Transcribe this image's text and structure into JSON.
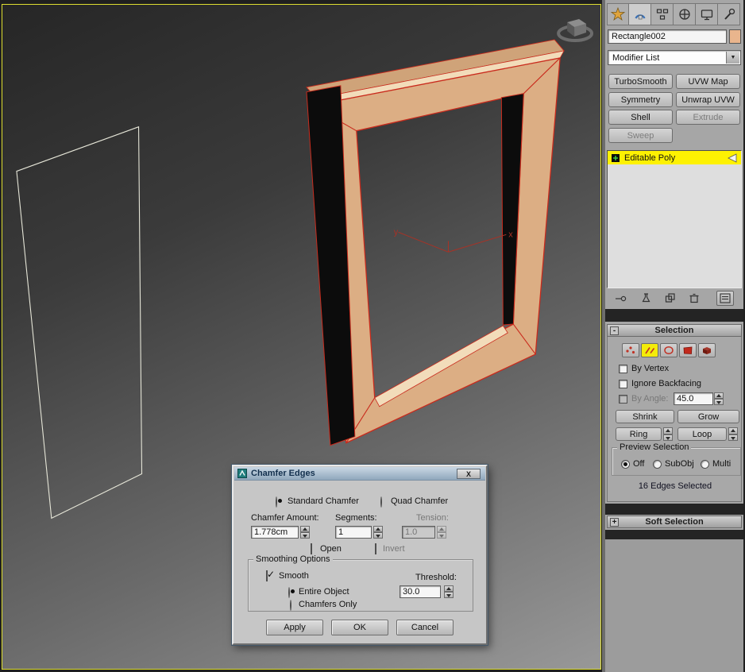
{
  "glyphs": {
    "dropdown_arrow": "▼",
    "collapse_minus": "-",
    "expand_plus": "+"
  },
  "colors": {
    "active_border_yellow": "#dede30",
    "selection_red": "#c92b1d",
    "frame_tan": "#dcae84",
    "frame_chamfer_light": "#f2dcba",
    "stack_highlight_yellow": "#fdf102",
    "object_color_swatch": "#e9b58d"
  },
  "viewport": {
    "axis_x_label": "x",
    "axis_y_label": "y"
  },
  "command_panel": {
    "tabs": [
      "create",
      "modify",
      "hierarchy",
      "motion",
      "display",
      "utilities"
    ],
    "active_tab": "modify",
    "object_name": "Rectangle002",
    "modifier_list_label": "Modifier List",
    "buttons": {
      "turbosmooth": "TurboSmooth",
      "uvw_map": "UVW Map",
      "symmetry": "Symmetry",
      "unwrap_uvw": "Unwrap UVW",
      "shell": "Shell",
      "extrude": "Extrude",
      "sweep": "Sweep"
    },
    "stack_item": "Editable Poly",
    "selection": {
      "title": "Selection",
      "by_vertex": "By Vertex",
      "ignore_backfacing": "Ignore Backfacing",
      "by_angle": "By Angle:",
      "by_angle_value": "45.0",
      "shrink": "Shrink",
      "grow": "Grow",
      "ring": "Ring",
      "loop": "Loop",
      "preview_title": "Preview Selection",
      "preview_off": "Off",
      "preview_subobj": "SubObj",
      "preview_multi": "Multi",
      "status": "16 Edges Selected"
    },
    "soft_selection_title": "Soft Selection"
  },
  "dialog": {
    "title": "Chamfer Edges",
    "close": "X",
    "standard_chamfer": "Standard Chamfer",
    "quad_chamfer": "Quad Chamfer",
    "chamfer_amount_label": "Chamfer Amount:",
    "segments_label": "Segments:",
    "tension_label": "Tension:",
    "chamfer_amount_value": "1.778cm",
    "segments_value": "1",
    "tension_value": "1.0",
    "open_label": "Open",
    "invert_label": "Invert",
    "smoothing_title": "Smoothing Options",
    "smooth_label": "Smooth",
    "threshold_label": "Threshold:",
    "threshold_value": "30.0",
    "entire_object": "Entire Object",
    "chamfers_only": "Chamfers Only",
    "apply": "Apply",
    "ok": "OK",
    "cancel": "Cancel"
  }
}
